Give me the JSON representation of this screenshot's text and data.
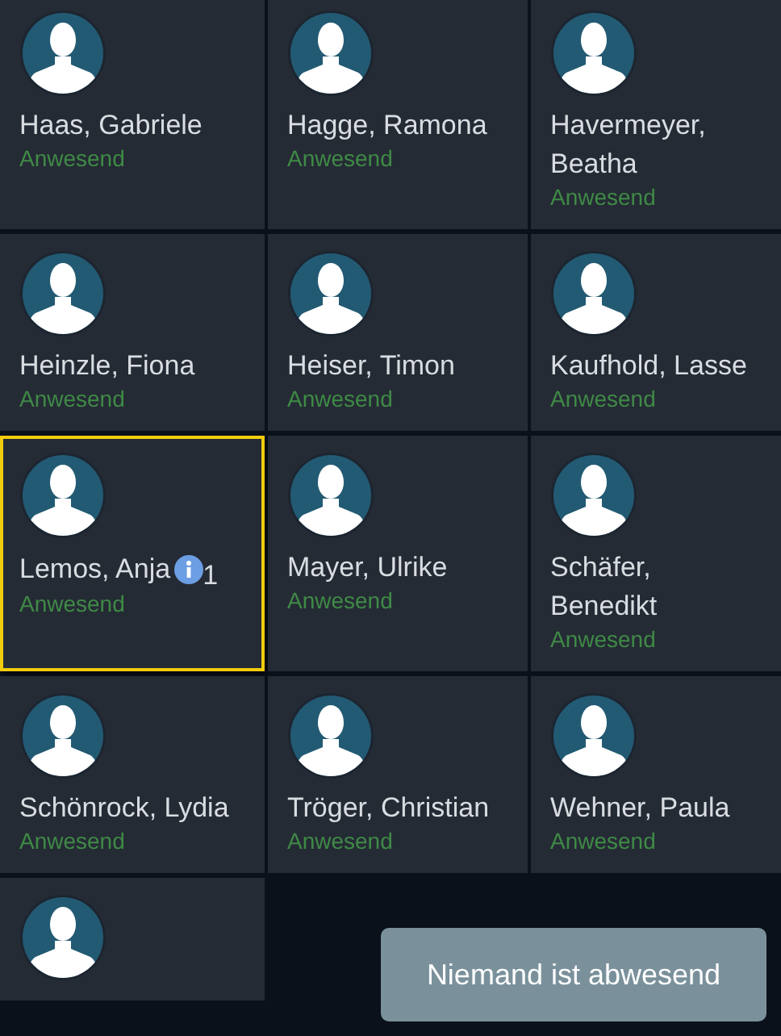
{
  "people": [
    {
      "name": "Haas, Gabriele",
      "status": "Anwesend",
      "selected": false
    },
    {
      "name": "Hagge, Ramona",
      "status": "Anwesend",
      "selected": false
    },
    {
      "name": "Havermeyer, Beatha",
      "status": "Anwesend",
      "selected": false
    },
    {
      "name": "Heinzle, Fiona",
      "status": "Anwesend",
      "selected": false
    },
    {
      "name": "Heiser, Timon",
      "status": "Anwesend",
      "selected": false
    },
    {
      "name": "Kaufhold, Lasse",
      "status": "Anwesend",
      "selected": false
    },
    {
      "name": "Lemos, Anja",
      "status": "Anwesend",
      "selected": true,
      "info_count": "1"
    },
    {
      "name": "Mayer, Ulrike",
      "status": "Anwesend",
      "selected": false
    },
    {
      "name": "Schäfer, Benedikt",
      "status": "Anwesend",
      "selected": false
    },
    {
      "name": "Schönrock, Lydia",
      "status": "Anwesend",
      "selected": false
    },
    {
      "name": "Tröger, Christian",
      "status": "Anwesend",
      "selected": false
    },
    {
      "name": "Wehner, Paula",
      "status": "Anwesend",
      "selected": false
    },
    {
      "selected": false
    }
  ],
  "action_button": "Niemand ist abwesend"
}
